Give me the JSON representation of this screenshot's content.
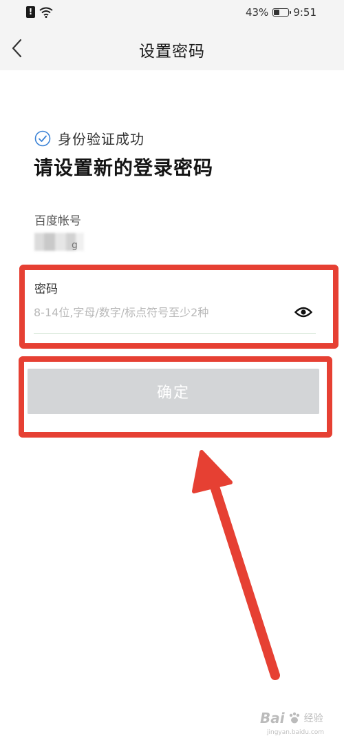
{
  "status_bar": {
    "battery_text": "43%",
    "battery_level": 0.43,
    "time": "9:51"
  },
  "nav": {
    "title": "设置密码"
  },
  "verify": {
    "status_text": "身份验证成功"
  },
  "heading": "请设置新的登录密码",
  "account": {
    "label": "百度帐号",
    "value_tail": "g"
  },
  "password": {
    "label": "密码",
    "value": "",
    "placeholder": "8-14位,字母/数字/标点符号至少2种"
  },
  "confirm_button": {
    "label": "确定"
  },
  "watermark": {
    "logo": "Bai",
    "sub": "经验",
    "url": "jingyan.baidu.com"
  },
  "colors": {
    "highlight": "#e64033",
    "button_disabled": "#d3d5d7",
    "check_blue": "#3a82d6",
    "nav_bg": "#f4f4f4"
  }
}
